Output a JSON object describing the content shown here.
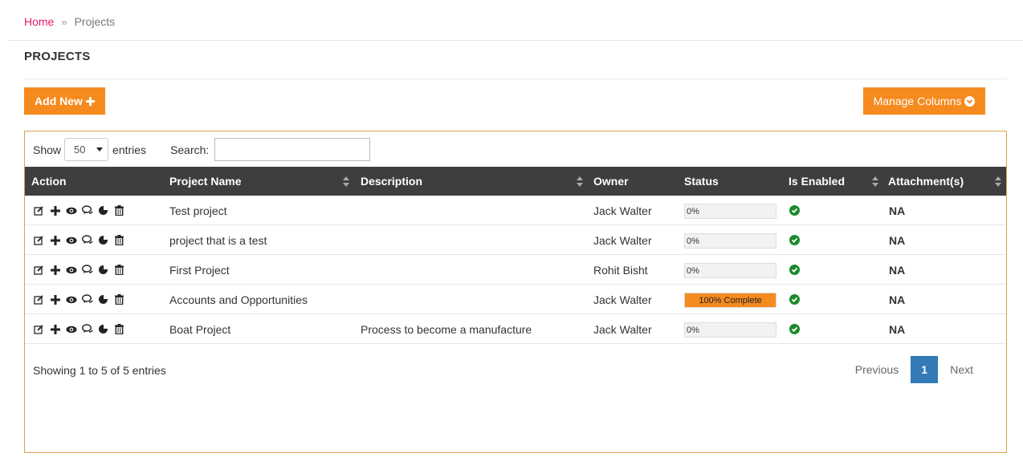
{
  "breadcrumb": {
    "home": "Home",
    "separator": "»",
    "current": "Projects"
  },
  "page": {
    "title": "PROJECTS"
  },
  "toolbar": {
    "add_new": "Add New",
    "manage_columns": "Manage Columns"
  },
  "controls": {
    "show": "Show",
    "entries_value": "50",
    "entries": "entries",
    "search_label": "Search:",
    "search_value": ""
  },
  "columns": [
    "Action",
    "Project Name",
    "Description",
    "Owner",
    "Status",
    "Is Enabled",
    "Attachment(s)"
  ],
  "rows": [
    {
      "name": "Test project",
      "description": "",
      "owner": "Jack Walter",
      "status": "0%",
      "progress": 0,
      "enabled": true,
      "attachment": "NA"
    },
    {
      "name": "project that is a test",
      "description": "",
      "owner": "Jack Walter",
      "status": "0%",
      "progress": 0,
      "enabled": true,
      "attachment": "NA"
    },
    {
      "name": "First Project",
      "description": "",
      "owner": "Rohit Bisht",
      "status": "0%",
      "progress": 0,
      "enabled": true,
      "attachment": "NA"
    },
    {
      "name": "Accounts and Opportunities",
      "description": "",
      "owner": "Jack Walter",
      "status": "100% Complete",
      "progress": 100,
      "enabled": true,
      "attachment": "NA"
    },
    {
      "name": "Boat Project",
      "description": "Process to become a manufacture",
      "owner": "Jack Walter",
      "status": "0%",
      "progress": 0,
      "enabled": true,
      "attachment": "NA"
    }
  ],
  "footer": {
    "info": "Showing 1 to 5 of 5 entries",
    "previous": "Previous",
    "page": "1",
    "next": "Next"
  },
  "colors": {
    "accent": "#f58a1f",
    "link": "#e6196e",
    "header_bg": "#3e3e3e",
    "pager_active": "#337ab7",
    "enabled": "#1a8a2a"
  }
}
